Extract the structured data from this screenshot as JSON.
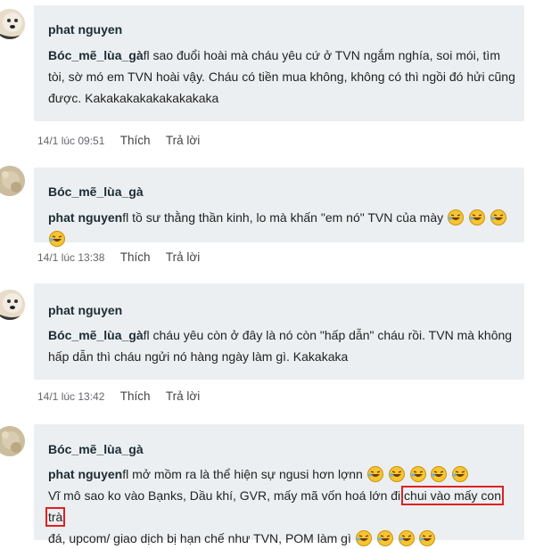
{
  "comments": [
    {
      "author": "phat nguyen",
      "mention": "Bóc_mẽ_lùa_gà",
      "text": "fl sao đuổi hoài mà cháu yêu cứ ở TVN ngắm nghía, soi mói, tìm tòi, sờ mó em TVN hoài vậy. Cháu có tiền mua không, không có thì ngồi đó hửi cũng được. Kakakakakakakakakaka",
      "time": "14/1 lúc 09:51",
      "like": "Thích",
      "reply": "Trả lời"
    },
    {
      "author": "Bóc_mẽ_lùa_gà",
      "mention": "phat nguyen",
      "text": "fl tồ sư thằng thần kinh, lo mà khấn \"em nó\" TVN của mày",
      "time": "14/1 lúc 13:38",
      "like": "Thích",
      "reply": "Trả lời"
    },
    {
      "author": "phat nguyen",
      "mention": "Bóc_mẽ_lùa_gà",
      "text": "fl cháu yêu còn ở đây là nó còn \"hấp dẫn\" cháu rồi. TVN mà không hấp dẫn thì cháu ngửi nó hàng ngày làm gì. Kakakaka",
      "time": "14/1 lúc 13:42",
      "like": "Thích",
      "reply": "Trả lời"
    },
    {
      "author": "Bóc_mẽ_lùa_gà",
      "mention": "phat nguyen",
      "text_line1": "fl mở mồm ra là thể hiện sự ngusi hơn lợnn",
      "text_line2_pre": "Vĩ mô sao ko vào Bạnks, Dầu khí, GVR, mấy mã vốn hoá lớn đi",
      "text_line2_hl": "chui vào mấy con trà",
      "text_line3": "đá, upcom/ giao dịch bị hạn chế như TVN, POM làm gì"
    }
  ],
  "colors": {
    "bubble": "#eceff1",
    "highlight": "#e02020"
  },
  "icons": {
    "emoji": "rolling-on-floor-laughing-icon"
  }
}
